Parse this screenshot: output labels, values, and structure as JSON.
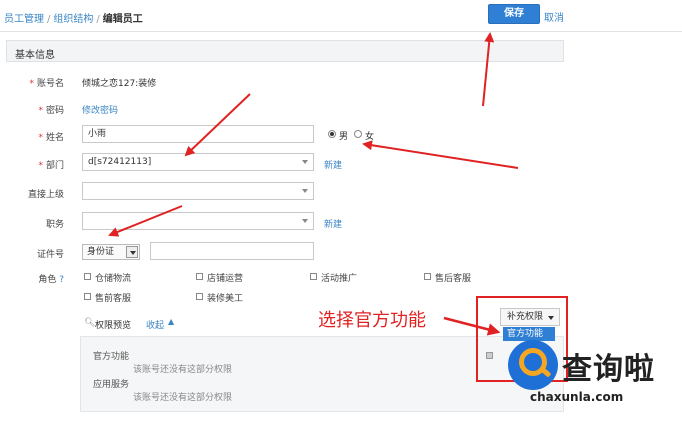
{
  "breadcrumb": {
    "items": [
      "员工管理",
      "组织结构"
    ],
    "sep": "/",
    "current": "编辑员工"
  },
  "toolbar": {
    "save_label": "保存",
    "cancel_label": "取消"
  },
  "section": {
    "title": "基本信息"
  },
  "form": {
    "account": {
      "label": "账号名",
      "required": "*",
      "value": "倾城之恋127:装修"
    },
    "password": {
      "label": "密码",
      "required": "*",
      "link": "修改密码"
    },
    "name": {
      "label": "姓名",
      "required": "*",
      "value": "小雨"
    },
    "gender": {
      "male": "男",
      "female": "女",
      "selected": "男"
    },
    "department": {
      "label": "部门",
      "required": "*",
      "value": "d[s72412113]",
      "link": "新建"
    },
    "supervisor": {
      "label": "直接上级",
      "value": ""
    },
    "position": {
      "label": "职务",
      "value": "",
      "link": "新建"
    },
    "id_doc": {
      "label": "证件号",
      "type_value": "身份证",
      "value": ""
    },
    "roles": {
      "label": "角色",
      "help": "?",
      "options": [
        "仓储物流",
        "店铺运营",
        "活动推广",
        "售后客服",
        "售前客服",
        "装修美工"
      ]
    }
  },
  "permissions": {
    "preview_label": "权限预览",
    "collapse_label": "收起",
    "extra_button": "补充权限",
    "dropdown_option": "官方功能",
    "groups": [
      {
        "title": "官方功能",
        "note": "该账号还没有这部分权限"
      },
      {
        "title": "应用服务",
        "note": "该账号还没有这部分权限"
      }
    ]
  },
  "annotation": {
    "text": "选择官方功能"
  },
  "watermark": {
    "brand": "查询啦",
    "domain": "chaxunla.com"
  },
  "colors": {
    "accent": "#2f7fd4",
    "link": "#3a85c5",
    "annotation": "#e02222",
    "watermark_orange": "#f5a623"
  }
}
